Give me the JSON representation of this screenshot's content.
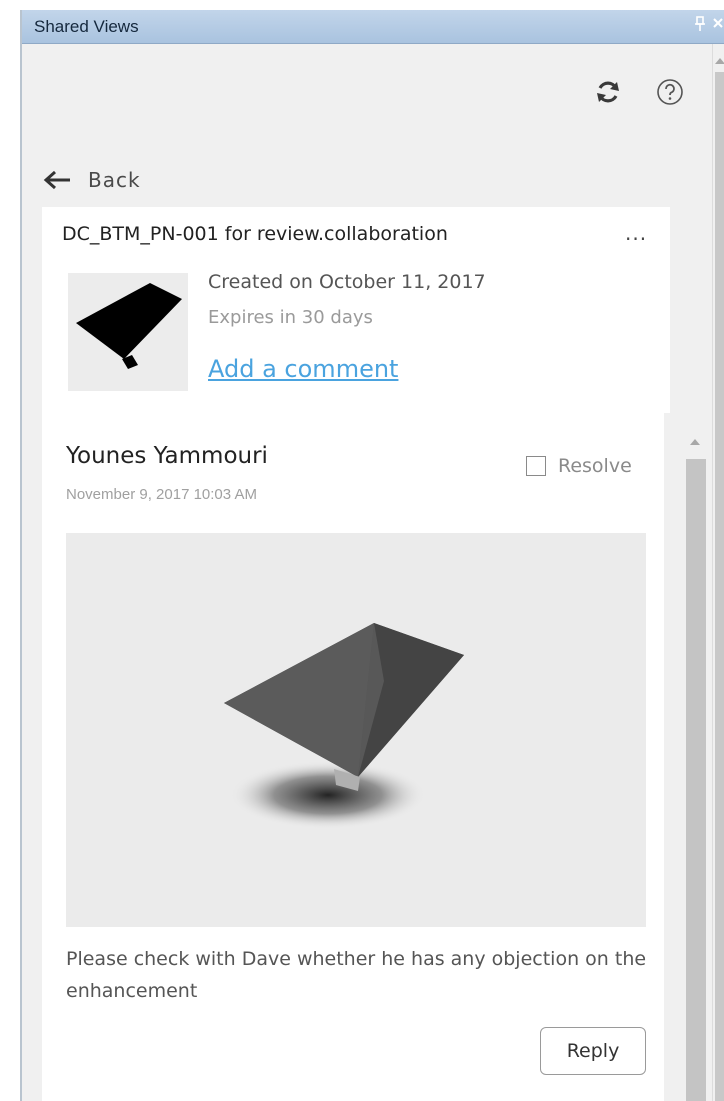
{
  "panel": {
    "title": "Shared Views",
    "pin_glyph": "ꟸ",
    "close_glyph": "×"
  },
  "toolbar": {
    "refresh_icon": "refresh-icon",
    "help_icon": "help-icon"
  },
  "navigation": {
    "back_label": "Back"
  },
  "shared_view": {
    "title": "DC_BTM_PN-001 for review.collaboration",
    "more_label": "...",
    "created": "Created on October 11, 2017",
    "expires": "Expires in 30 days",
    "add_comment": "Add a comment"
  },
  "comment": {
    "author": "Younes Yammouri",
    "date": "November 9, 2017 10:03 AM",
    "resolve_label": "Resolve",
    "resolved": false,
    "body": "Please check with Dave whether he has any objection on the enhancement",
    "reply_label": "Reply"
  },
  "colors": {
    "titlebar": "#a9c3df",
    "link": "#4aa3df",
    "panel_background": "#f0f0f0"
  }
}
